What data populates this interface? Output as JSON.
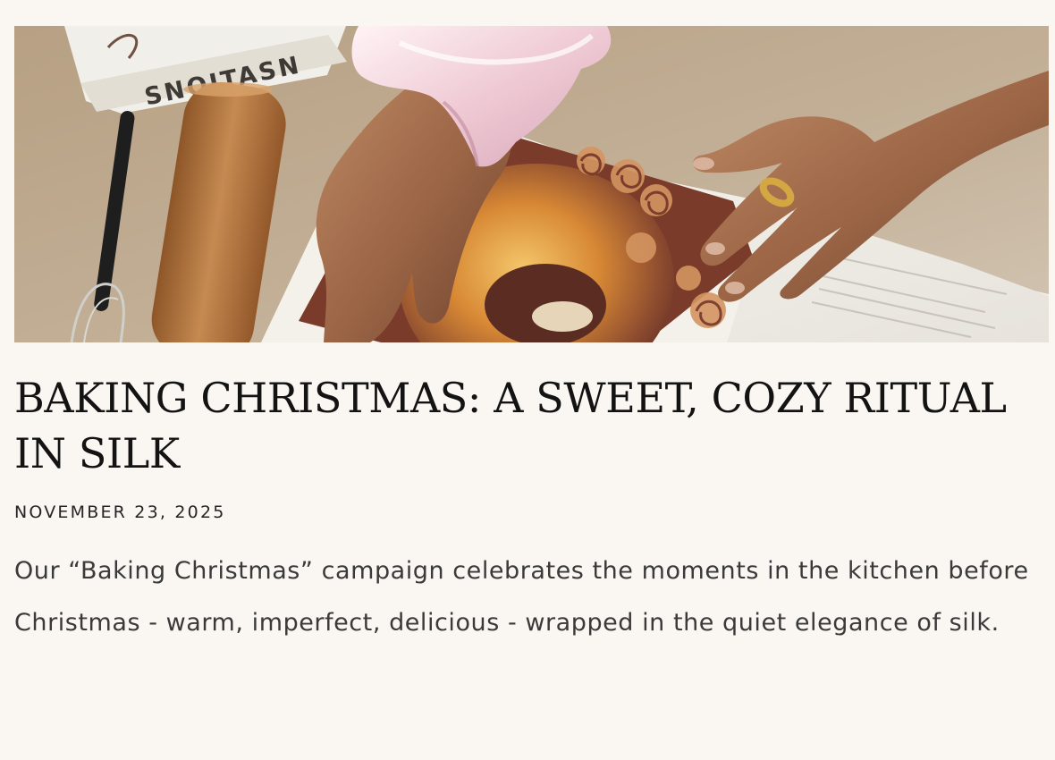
{
  "article": {
    "image": {
      "book_spine_text": "SNOITASN",
      "colors": {
        "background": "#faf7f2",
        "counter": "#b89f84",
        "silk_pink": "#f2d4dd",
        "cake_brown": "#6d3325",
        "skin": "#a6704d"
      }
    },
    "title": "BAKING CHRISTMAS: A SWEET, COZY RITUAL IN SILK",
    "date": "NOVEMBER 23, 2025",
    "excerpt": "Our “Baking Christmas” campaign celebrates the moments in the kitchen before Christmas - warm, imperfect, delicious - wrapped in the quiet elegance of silk."
  }
}
